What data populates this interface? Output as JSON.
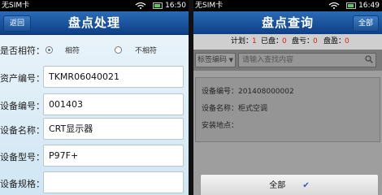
{
  "left": {
    "status": {
      "carrier": "无SIM卡",
      "time": "16:50"
    },
    "header": {
      "back_label": "返回",
      "title": "盘点处理"
    },
    "match": {
      "label": "是否相符：",
      "option_match": "相符",
      "option_mismatch": "不相符",
      "selected": "相符"
    },
    "fields": [
      {
        "label": "资产编号：",
        "value": "TKMR06040021"
      },
      {
        "label": "设备编号：",
        "value": "001403"
      },
      {
        "label": "设备名称：",
        "value": "CRT显示器"
      },
      {
        "label": "设备型号：",
        "value": "P97F+"
      },
      {
        "label": "设备规格：",
        "value": ""
      }
    ]
  },
  "right": {
    "status": {
      "carrier": "无SIM卡",
      "time": "16:49"
    },
    "header": {
      "title": "盘点查询",
      "all_label": "全部"
    },
    "counts": {
      "plan_label": "计划：",
      "plan": "1",
      "done_label": "已盘：",
      "done": "0",
      "loss_label": "盘亏：",
      "loss": "0",
      "gain_label": "盘盈：",
      "gain": "0"
    },
    "search": {
      "dropdown": "标签编码",
      "placeholder": "请输入查找内容"
    },
    "record": {
      "code": "设备编号：201408000002",
      "name": "设备名称：柜式空调",
      "location": "安装地点："
    },
    "sheet": {
      "label": "全部"
    }
  },
  "colors": {
    "header_blue": "#0d3f86",
    "accent_red": "#d21"
  }
}
